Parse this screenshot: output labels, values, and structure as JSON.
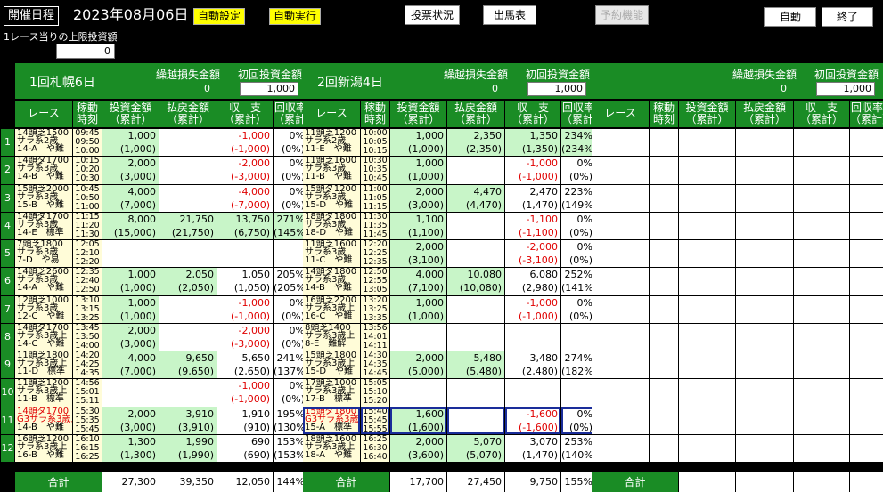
{
  "toolbar": {
    "schedule_label": "開催日程",
    "date": "2023年08月06日",
    "auto_settings": "自動設定",
    "auto_run": "自動実行",
    "vote_status": "投票状況",
    "entries": "出馬表",
    "reservation": "予約機能",
    "auto_toggle": "自動",
    "exit": "終了"
  },
  "limit": {
    "label": "1レース当りの上限投資額",
    "value": "0"
  },
  "colors": {
    "green": "#1a8c25",
    "light_green": "#c8f5c8",
    "yellow": "#fffcd8",
    "red": "#e00000"
  },
  "headers": {
    "race": "レース",
    "time": [
      "稼動",
      "時刻"
    ],
    "invest": [
      "投資金額",
      "（累計）"
    ],
    "payout": [
      "払戻金額",
      "（累計）"
    ],
    "balance": [
      "収　支",
      "（累計）"
    ],
    "rate": [
      "回収率",
      "（累計）"
    ]
  },
  "meetings": [
    {
      "name": "1回札幌6日",
      "carry_label": "繰越損失金額",
      "carry_value": "0",
      "init_label": "初回投資金額",
      "init_value": "1,000",
      "races": [
        {
          "lines": [
            "14頭芝1500",
            "サラ系2歳",
            "14-A　や難"
          ],
          "times": [
            "09:45",
            "09:50",
            "10:00"
          ],
          "inv": [
            "1,000",
            "(1,000)"
          ],
          "pay": [
            "",
            ""
          ],
          "bal": [
            "-1,000",
            "(-1,000)"
          ],
          "rate": [
            "0%",
            "(0%)"
          ],
          "neg": true,
          "hl": false
        },
        {
          "lines": [
            "14頭ダ1700",
            "サラ系3歳",
            "14-B　や難"
          ],
          "times": [
            "10:15",
            "10:20",
            "10:30"
          ],
          "inv": [
            "2,000",
            "(3,000)"
          ],
          "pay": [
            "",
            ""
          ],
          "bal": [
            "-2,000",
            "(-3,000)"
          ],
          "rate": [
            "0%",
            "(0%)"
          ],
          "neg": true,
          "hl": false
        },
        {
          "lines": [
            "15頭芝2000",
            "サラ系3歳",
            "15-B　や難"
          ],
          "times": [
            "10:45",
            "10:50",
            "11:00"
          ],
          "inv": [
            "4,000",
            "(7,000)"
          ],
          "pay": [
            "",
            ""
          ],
          "bal": [
            "-4,000",
            "(-7,000)"
          ],
          "rate": [
            "0%",
            "(0%)"
          ],
          "neg": true,
          "hl": false
        },
        {
          "lines": [
            "14頭ダ1700",
            "サラ系3歳",
            "14-E　標準"
          ],
          "times": [
            "11:15",
            "11:20",
            "11:30"
          ],
          "inv": [
            "8,000",
            "(15,000)"
          ],
          "pay": [
            "21,750",
            "(21,750)"
          ],
          "bal": [
            "13,750",
            "(6,750)"
          ],
          "rate": [
            "271%",
            "(145%)"
          ],
          "neg": false,
          "hl": true
        },
        {
          "lines": [
            "7頭芝1800",
            "サラ系3歳",
            "7-D　や易"
          ],
          "times": [
            "12:05",
            "12:10",
            "12:20"
          ],
          "inv": [
            "",
            ""
          ],
          "pay": [
            "",
            ""
          ],
          "bal": [
            "",
            ""
          ],
          "rate": [
            "",
            ""
          ],
          "neg": false,
          "hl": false
        },
        {
          "lines": [
            "14頭芝2600",
            "サラ系3歳",
            "14-A　や難"
          ],
          "times": [
            "12:35",
            "12:40",
            "12:50"
          ],
          "inv": [
            "1,000",
            "(1,000)"
          ],
          "pay": [
            "2,050",
            "(2,050)"
          ],
          "bal": [
            "1,050",
            "(1,050)"
          ],
          "rate": [
            "205%",
            "(205%)"
          ],
          "neg": false,
          "hl": false
        },
        {
          "lines": [
            "12頭芝1000",
            "サラ系3歳",
            "12-C　や難"
          ],
          "times": [
            "13:10",
            "13:15",
            "13:25"
          ],
          "inv": [
            "1,000",
            "(1,000)"
          ],
          "pay": [
            "",
            ""
          ],
          "bal": [
            "-1,000",
            "(-1,000)"
          ],
          "rate": [
            "0%",
            "(0%)"
          ],
          "neg": true,
          "hl": false
        },
        {
          "lines": [
            "14頭ダ1700",
            "サラ系3歳上",
            "14-C　や難"
          ],
          "times": [
            "13:45",
            "13:50",
            "14:00"
          ],
          "inv": [
            "2,000",
            "(3,000)"
          ],
          "pay": [
            "",
            ""
          ],
          "bal": [
            "-2,000",
            "(-3,000)"
          ],
          "rate": [
            "0%",
            "(0%)"
          ],
          "neg": true,
          "hl": false
        },
        {
          "lines": [
            "11頭芝1800",
            "サラ系3歳上",
            "11-D　標準"
          ],
          "times": [
            "14:20",
            "14:25",
            "14:35"
          ],
          "inv": [
            "4,000",
            "(7,000)"
          ],
          "pay": [
            "9,650",
            "(9,650)"
          ],
          "bal": [
            "5,650",
            "(2,650)"
          ],
          "rate": [
            "241%",
            "(137%)"
          ],
          "neg": false,
          "hl": false
        },
        {
          "lines": [
            "11頭芝1200",
            "サラ系3歳上",
            "11-B　標準"
          ],
          "times": [
            "14:56",
            "15:01",
            "15:11"
          ],
          "inv": [
            "",
            ""
          ],
          "pay": [
            "",
            ""
          ],
          "bal": [
            "-1,000",
            "(-1,000)"
          ],
          "rate": [
            "0%",
            "(0%)"
          ],
          "neg": true,
          "hl": false
        },
        {
          "lines": [
            "14頭ダ1700",
            "G3サラ系3歳上",
            "14-B　や難"
          ],
          "times": [
            "15:30",
            "15:35",
            "15:45"
          ],
          "inv": [
            "2,000",
            "(3,000)"
          ],
          "pay": [
            "3,910",
            "(3,910)"
          ],
          "bal": [
            "1,910",
            "(910)"
          ],
          "rate": [
            "195%",
            "(130%)"
          ],
          "neg": false,
          "hl": false,
          "g3": true
        },
        {
          "lines": [
            "16頭芝1200",
            "サラ系3歳上",
            "16-B　や難"
          ],
          "times": [
            "16:10",
            "16:15",
            "16:25"
          ],
          "inv": [
            "1,300",
            "(1,300)"
          ],
          "pay": [
            "1,990",
            "(1,990)"
          ],
          "bal": [
            "690",
            "(690)"
          ],
          "rate": [
            "153%",
            "(153%)"
          ],
          "neg": false,
          "hl": false
        }
      ],
      "totals": {
        "inv": "27,300",
        "pay": "39,350",
        "bal": "12,050",
        "rate": "144%"
      }
    },
    {
      "name": "2回新潟4日",
      "carry_label": "繰越損失金額",
      "carry_value": "0",
      "init_label": "初回投資金額",
      "init_value": "1,000",
      "races": [
        {
          "lines": [
            "11頭芝1200",
            "サラ系2歳",
            "11-E　や難"
          ],
          "times": [
            "10:00",
            "10:05",
            "10:15"
          ],
          "inv": [
            "1,000",
            "(1,000)"
          ],
          "pay": [
            "2,350",
            "(2,350)"
          ],
          "bal": [
            "1,350",
            "(1,350)"
          ],
          "rate": [
            "234%",
            "(234%)"
          ],
          "neg": false,
          "hl": true
        },
        {
          "lines": [
            "11頭芝1600",
            "サラ系3歳",
            "11-B　や難"
          ],
          "times": [
            "10:30",
            "10:35",
            "10:45"
          ],
          "inv": [
            "1,000",
            "(1,000)"
          ],
          "pay": [
            "",
            ""
          ],
          "bal": [
            "-1,000",
            "(-1,000)"
          ],
          "rate": [
            "0%",
            "(0%)"
          ],
          "neg": true,
          "hl": false
        },
        {
          "lines": [
            "15頭ダ1200",
            "サラ系3歳",
            "15-D　や難"
          ],
          "times": [
            "11:00",
            "11:05",
            "11:15"
          ],
          "inv": [
            "2,000",
            "(3,000)"
          ],
          "pay": [
            "4,470",
            "(4,470)"
          ],
          "bal": [
            "2,470",
            "(1,470)"
          ],
          "rate": [
            "223%",
            "(149%)"
          ],
          "neg": false,
          "hl": false
        },
        {
          "lines": [
            "18頭ダ1800",
            "サラ系3歳",
            "18-D　や難"
          ],
          "times": [
            "11:30",
            "11:35",
            "11:45"
          ],
          "inv": [
            "1,100",
            "(1,100)"
          ],
          "pay": [
            "",
            ""
          ],
          "bal": [
            "-1,100",
            "(-1,100)"
          ],
          "rate": [
            "0%",
            "(0%)"
          ],
          "neg": true,
          "hl": false
        },
        {
          "lines": [
            "11頭芝1600",
            "サラ系3歳",
            "11-C　や難"
          ],
          "times": [
            "12:20",
            "12:25",
            "12:35"
          ],
          "inv": [
            "2,000",
            "(3,100)"
          ],
          "pay": [
            "",
            ""
          ],
          "bal": [
            "-2,000",
            "(-3,100)"
          ],
          "rate": [
            "0%",
            "(0%)"
          ],
          "neg": true,
          "hl": false
        },
        {
          "lines": [
            "14頭ダ1800",
            "サラ系3歳",
            "14-B　や難"
          ],
          "times": [
            "12:50",
            "12:55",
            "13:05"
          ],
          "inv": [
            "4,000",
            "(7,100)"
          ],
          "pay": [
            "10,080",
            "(10,080)"
          ],
          "bal": [
            "6,080",
            "(2,980)"
          ],
          "rate": [
            "252%",
            "(141%)"
          ],
          "neg": false,
          "hl": false
        },
        {
          "lines": [
            "16頭芝2200",
            "サラ系3歳上",
            "16-C　や難"
          ],
          "times": [
            "13:20",
            "13:25",
            "13:35"
          ],
          "inv": [
            "1,000",
            "(1,000)"
          ],
          "pay": [
            "",
            ""
          ],
          "bal": [
            "-1,000",
            "(-1,000)"
          ],
          "rate": [
            "0%",
            "(0%)"
          ],
          "neg": true,
          "hl": false
        },
        {
          "lines": [
            "8頭芝1400",
            "サラ系3歳上",
            "8-E　難解"
          ],
          "times": [
            "13:56",
            "14:01",
            "14:11"
          ],
          "inv": [
            "",
            ""
          ],
          "pay": [
            "",
            ""
          ],
          "bal": [
            "",
            ""
          ],
          "rate": [
            "",
            ""
          ],
          "neg": false,
          "hl": false
        },
        {
          "lines": [
            "15頭芝1800",
            "サラ系3歳上",
            "15-D　や難"
          ],
          "times": [
            "14:30",
            "14:35",
            "14:45"
          ],
          "inv": [
            "2,000",
            "(5,000)"
          ],
          "pay": [
            "5,480",
            "(5,480)"
          ],
          "bal": [
            "3,480",
            "(2,480)"
          ],
          "rate": [
            "274%",
            "(182%)"
          ],
          "neg": false,
          "hl": false
        },
        {
          "lines": [
            "17頭芝1000",
            "サラ系3歳上",
            "17-B　標準"
          ],
          "times": [
            "15:05",
            "15:10",
            "15:20"
          ],
          "inv": [
            "",
            ""
          ],
          "pay": [
            "",
            ""
          ],
          "bal": [
            "",
            ""
          ],
          "rate": [
            "",
            ""
          ],
          "neg": false,
          "hl": false
        },
        {
          "lines": [
            "15頭ダ1800",
            "G3サラ系3歳上",
            "15-A　標準"
          ],
          "times": [
            "15:40",
            "15:45",
            "15:55"
          ],
          "inv": [
            "1,600",
            "(1,600)"
          ],
          "pay": [
            "",
            ""
          ],
          "bal": [
            "-1,600",
            "(-1,600)"
          ],
          "rate": [
            "0%",
            "(0%)"
          ],
          "neg": true,
          "hl": false,
          "g3": true,
          "sel": true
        },
        {
          "lines": [
            "18頭芝1600",
            "サラ系3歳上",
            "18-A　や難"
          ],
          "times": [
            "16:25",
            "16:30",
            "16:40"
          ],
          "inv": [
            "2,000",
            "(3,600)"
          ],
          "pay": [
            "5,070",
            "(5,070)"
          ],
          "bal": [
            "3,070",
            "(1,470)"
          ],
          "rate": [
            "253%",
            "(140%)"
          ],
          "neg": false,
          "hl": false
        }
      ],
      "totals": {
        "inv": "17,700",
        "pay": "27,450",
        "bal": "9,750",
        "rate": "155%"
      }
    },
    {
      "name": "",
      "carry_label": "繰越損失金額",
      "carry_value": "0",
      "init_label": "初回投資金額",
      "init_value": "1,000",
      "races": [],
      "totals": {
        "inv": "",
        "pay": "",
        "bal": "",
        "rate": ""
      }
    }
  ],
  "total_label": "合計"
}
